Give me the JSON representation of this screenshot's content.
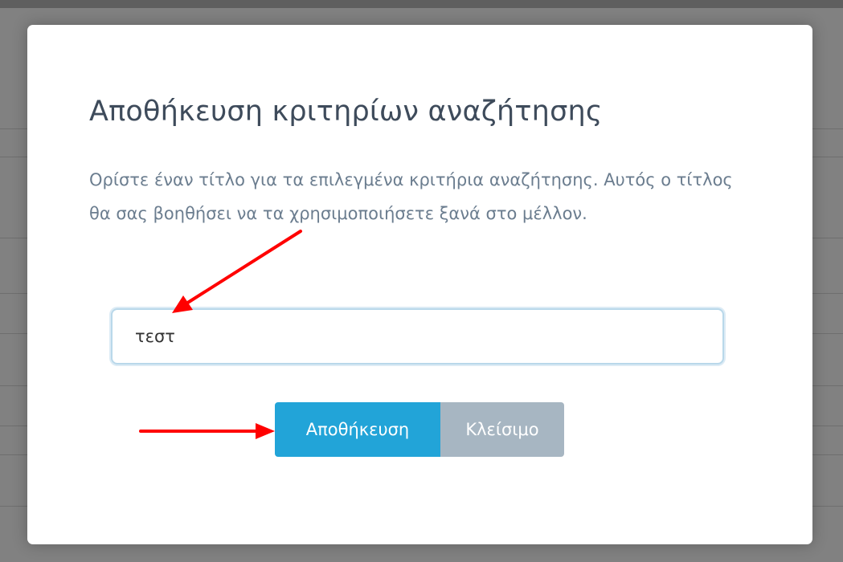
{
  "dialog": {
    "title": "Αποθήκευση κριτηρίων αναζήτησης",
    "description": "Ορίστε έναν τίτλο για τα επιλεγμένα κριτήρια αναζήτησης. Αυτός ο τίτλος θα σας βοηθήσει να τα χρησιμοποιήσετε ξανά στο μέλλον.",
    "input_value": "τεστ",
    "save_label": "Αποθήκευση",
    "close_label": "Κλείσιμο"
  },
  "colors": {
    "primary": "#22a4d8",
    "secondary": "#a7b6c2",
    "annotation_arrow": "#ff0000",
    "overlay": "#818181"
  }
}
